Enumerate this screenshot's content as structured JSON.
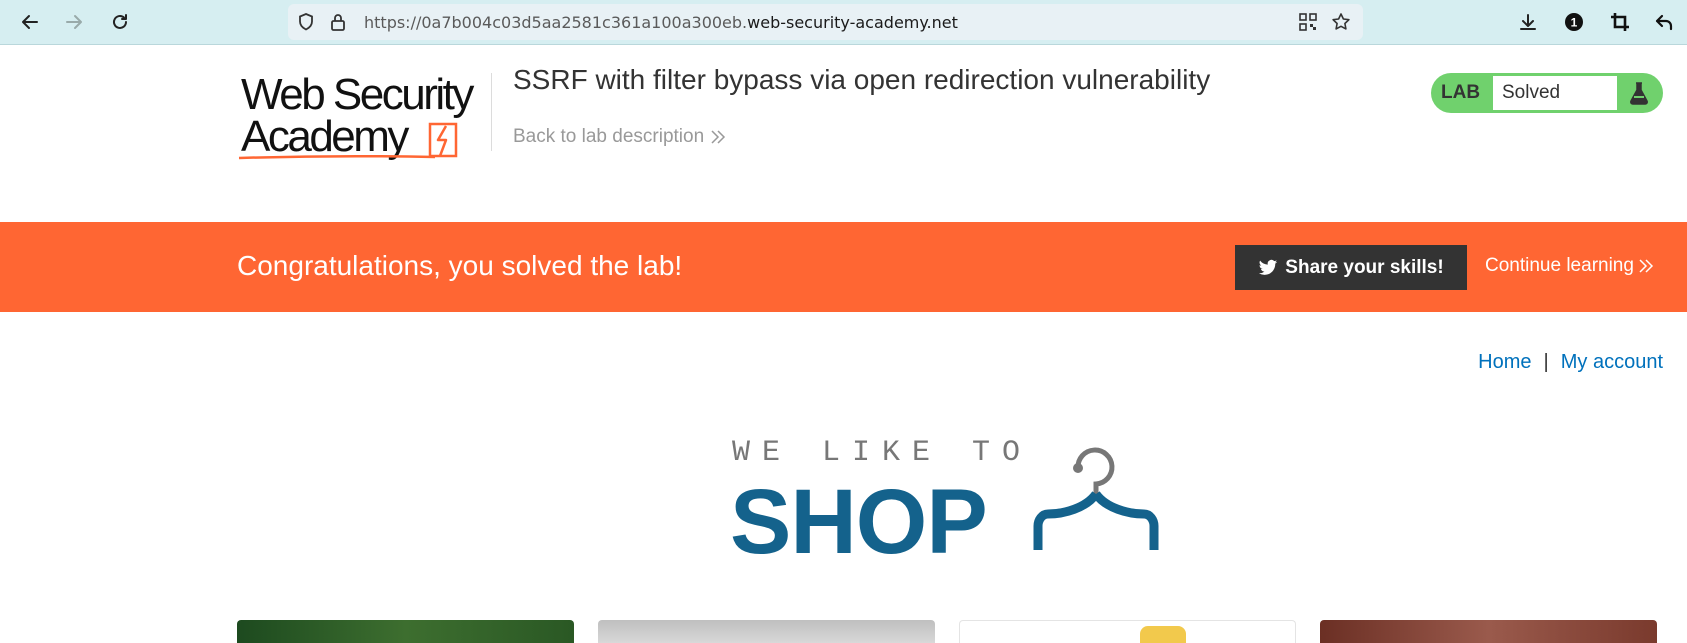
{
  "browser": {
    "url_prefix": "https://0a7b004c03d5aa2581c361a100a300eb.",
    "url_domain": "web-security-academy.net",
    "extensions_badge": "1"
  },
  "header": {
    "logo_line1": "Web Security",
    "logo_line2": "Academy",
    "lab_title": "SSRF with filter bypass via open redirection vulnerability",
    "back_link": "Back to lab description",
    "lab_badge_label": "LAB",
    "lab_status": "Solved"
  },
  "banner": {
    "message": "Congratulations, you solved the lab!",
    "share_label": "Share your skills!",
    "continue_label": "Continue learning"
  },
  "nav": {
    "home": "Home",
    "separator": "|",
    "account": "My account"
  },
  "shop_logo": {
    "tagline": "WE LIKE TO",
    "word": "SHOP"
  },
  "colors": {
    "banner": "#ff6633",
    "lab_badge": "#70d16d",
    "link": "#0071bc",
    "shop": "#14628c"
  }
}
